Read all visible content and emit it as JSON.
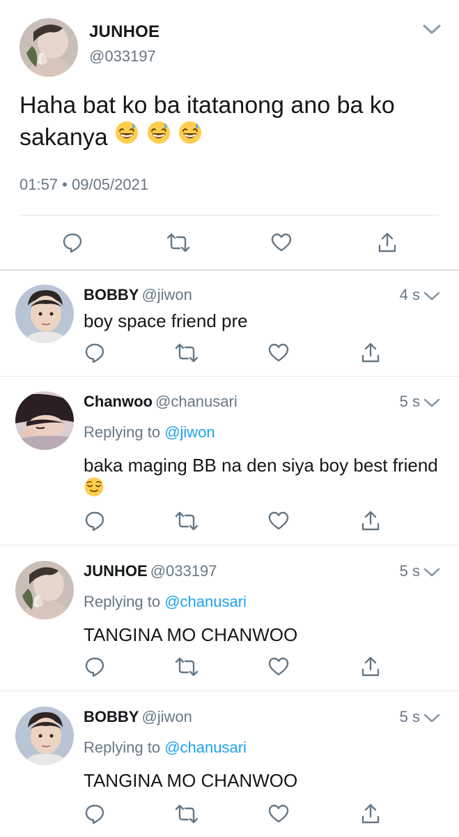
{
  "main_tweet": {
    "name": "JUNHOE",
    "handle": "@033197",
    "text": "Haha bat ko ba itatanong ano ba ko sakanya",
    "emojis": [
      "grinning-face-with-sweat",
      "grinning-face-with-sweat",
      "grinning-face-with-sweat"
    ],
    "timestamp": "01:57 • 09/05/2021",
    "avatar_icon": "avatar-junhoe"
  },
  "replies": [
    {
      "name": "BOBBY",
      "handle": "@jiwon",
      "time": "4 s",
      "replying_label": "",
      "replying_to": "",
      "text": "boy space friend pre",
      "emoji": "",
      "avatar_icon": "avatar-bobby"
    },
    {
      "name": "Chanwoo",
      "handle": "@chanusari",
      "time": "5 s",
      "replying_label": "Replying to",
      "replying_to": "@jiwon",
      "text": "baka maging BB na den siya boy best friend",
      "emoji": "relieved-face",
      "avatar_icon": "avatar-chanwoo"
    },
    {
      "name": "JUNHOE",
      "handle": "@033197",
      "time": "5 s",
      "replying_label": "Replying to",
      "replying_to": "@chanusari",
      "text": "TANGINA MO CHANWOO",
      "emoji": "",
      "avatar_icon": "avatar-junhoe"
    },
    {
      "name": "BOBBY",
      "handle": "@jiwon",
      "time": "5 s",
      "replying_label": "Replying to",
      "replying_to": "@chanusari",
      "text": "TANGINA MO CHANWOO",
      "emoji": "",
      "avatar_icon": "avatar-bobby"
    }
  ],
  "colors": {
    "text": "#14171a",
    "secondary": "#657786",
    "link": "#1da1f2",
    "divider": "#e1e8ed",
    "icon": "#657786"
  },
  "action_icons": [
    "reply-icon",
    "retweet-icon",
    "like-icon",
    "share-icon"
  ]
}
